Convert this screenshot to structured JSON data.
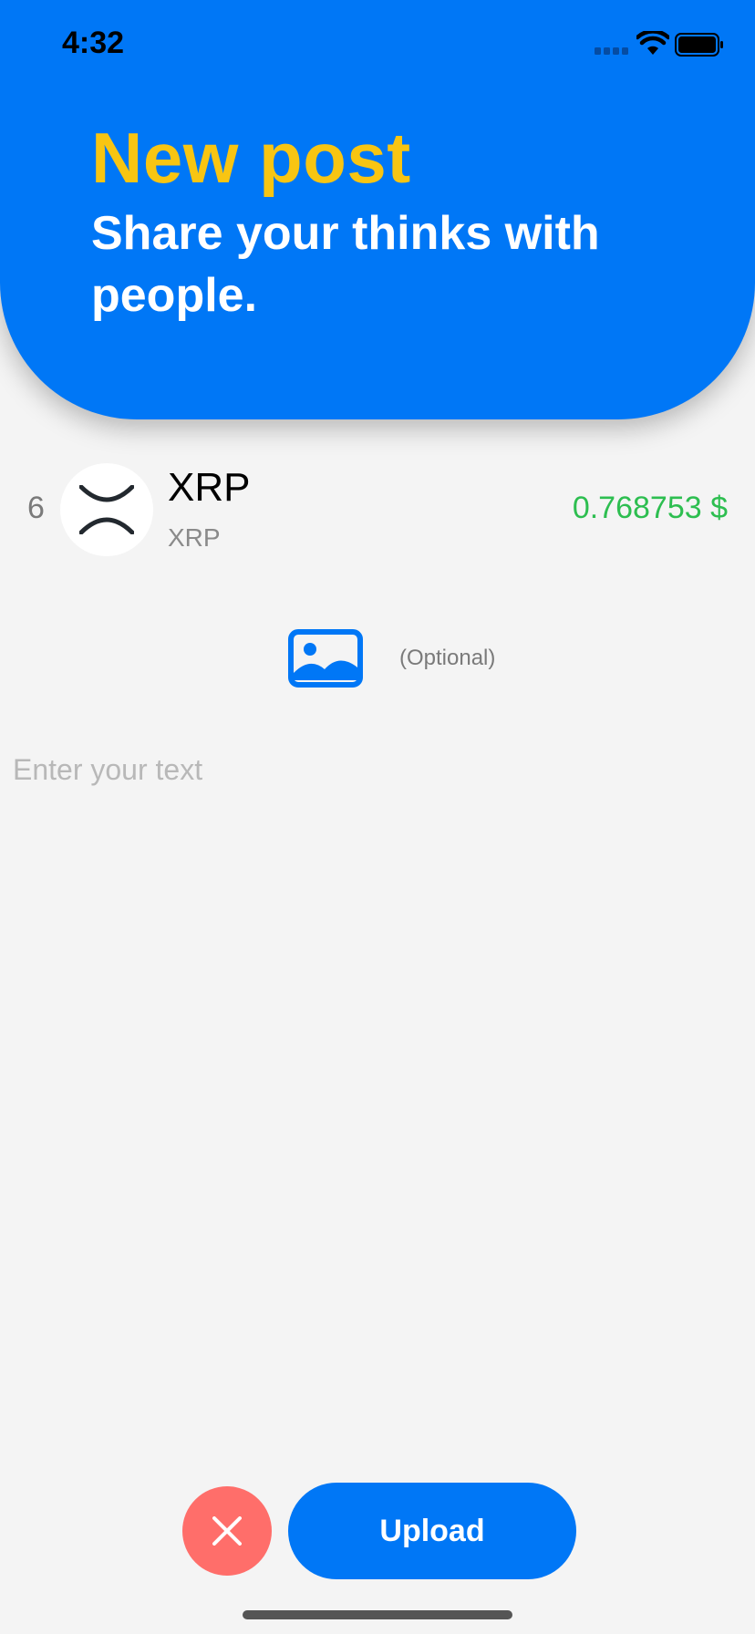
{
  "status_bar": {
    "time": "4:32",
    "icons": [
      "cellular-signal-icon",
      "wifi-icon",
      "battery-icon"
    ]
  },
  "header": {
    "title": "New post",
    "subtitle": "Share your thinks with people."
  },
  "coin": {
    "rank": "6",
    "name": "XRP",
    "symbol": "XRP",
    "price": "0.768753 $",
    "logo_icon": "xrp-logo-icon"
  },
  "image_picker": {
    "icon": "photo-icon",
    "optional_label": "(Optional)"
  },
  "post_input": {
    "placeholder": "Enter your text",
    "value": ""
  },
  "actions": {
    "cancel_icon": "close-icon",
    "upload_label": "Upload"
  },
  "colors": {
    "primary": "#0077f6",
    "title_accent": "#f8c512",
    "price_green": "#2dbe50",
    "cancel_red": "#ff6e6a",
    "background": "#f4f4f4"
  }
}
